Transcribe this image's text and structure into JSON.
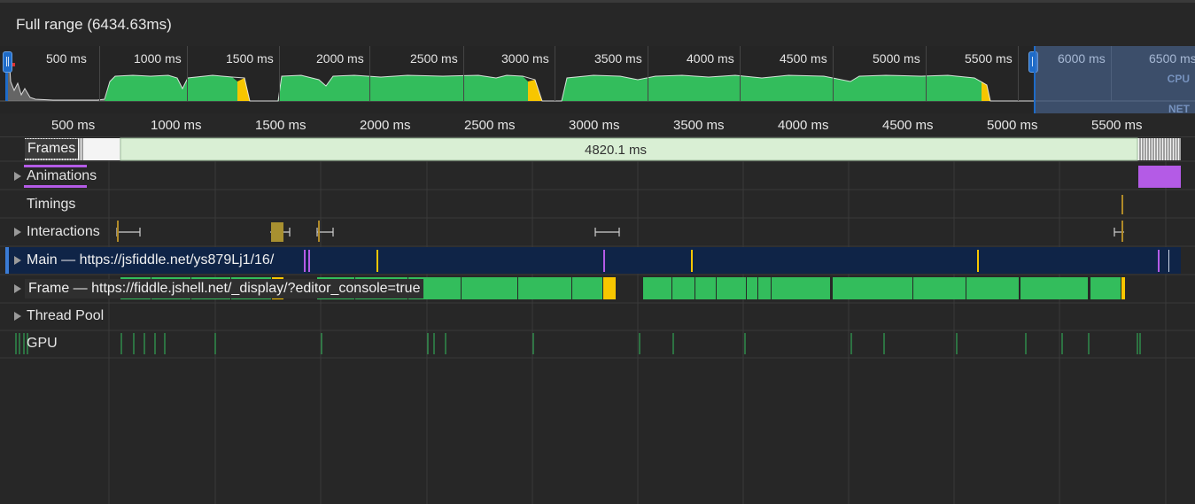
{
  "header": {
    "title": "Full range (6434.63ms)"
  },
  "overview": {
    "ticks": [
      "500 ms",
      "1000 ms",
      "1500 ms",
      "2000 ms",
      "2500 ms",
      "3000 ms",
      "3500 ms",
      "4000 ms",
      "4500 ms",
      "5000 ms",
      "5500 ms",
      "6000 ms",
      "6500 ms"
    ],
    "cpu_label": "CPU",
    "net_label": "NET"
  },
  "ruler": {
    "ticks": [
      "500 ms",
      "1000 ms",
      "1500 ms",
      "2000 ms",
      "2500 ms",
      "3000 ms",
      "3500 ms",
      "4000 ms",
      "4500 ms",
      "5000 ms",
      "5500 ms"
    ]
  },
  "tracks": {
    "frames": {
      "label": "Frames",
      "long_frame": "4820.1 ms"
    },
    "animations": {
      "label": "Animations"
    },
    "timings": {
      "label": "Timings"
    },
    "interactions": {
      "label": "Interactions"
    },
    "main": {
      "label": "Main — https://jsfiddle.net/ys879Lj1/16/"
    },
    "frame": {
      "label": "Frame — https://fiddle.jshell.net/_display/?editor_console=true"
    },
    "thread_pool": {
      "label": "Thread Pool"
    },
    "gpu": {
      "label": "GPU"
    }
  },
  "colors": {
    "scripting": "#33bd5c",
    "rendering": "#f7c600",
    "animation": "#b45be6",
    "main_bg": "#0f2447",
    "selection": "#1e6bc8",
    "frame_long": "#d9efd4"
  }
}
